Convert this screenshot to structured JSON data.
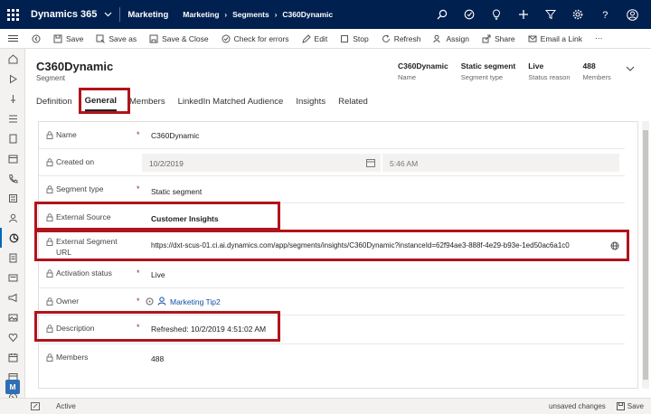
{
  "topbar": {
    "app_title": "Dynamics 365",
    "area": "Marketing",
    "breadcrumb": [
      "Marketing",
      "Segments",
      "C360Dynamic"
    ]
  },
  "commands": [
    {
      "label": "Save",
      "icon": "save-icon"
    },
    {
      "label": "Save as",
      "icon": "save-as-icon"
    },
    {
      "label": "Save & Close",
      "icon": "save-close-icon"
    },
    {
      "label": "Check for errors",
      "icon": "check-circle-icon"
    },
    {
      "label": "Edit",
      "icon": "edit-icon"
    },
    {
      "label": "Stop",
      "icon": "stop-icon"
    },
    {
      "label": "Refresh",
      "icon": "refresh-icon"
    },
    {
      "label": "Assign",
      "icon": "assign-icon"
    },
    {
      "label": "Share",
      "icon": "share-icon"
    },
    {
      "label": "Email a Link",
      "icon": "email-icon"
    }
  ],
  "record": {
    "title": "C360Dynamic",
    "subtitle": "Segment",
    "header_fields": [
      {
        "value": "C360Dynamic",
        "label": "Name"
      },
      {
        "value": "Static segment",
        "label": "Segment type"
      },
      {
        "value": "Live",
        "label": "Status reason"
      },
      {
        "value": "488",
        "label": "Members"
      }
    ]
  },
  "tabs": [
    "Definition",
    "General",
    "Members",
    "LinkedIn Matched Audience",
    "Insights",
    "Related"
  ],
  "active_tab": "General",
  "form": {
    "name": {
      "label": "Name",
      "value": "C360Dynamic"
    },
    "created_on": {
      "label": "Created on",
      "date": "10/2/2019",
      "time": "5:46 AM"
    },
    "segment_type": {
      "label": "Segment type",
      "value": "Static segment"
    },
    "external_source": {
      "label": "External Source",
      "value": "Customer Insights"
    },
    "external_url": {
      "label_line1": "External Segment",
      "label_line2": "URL",
      "value": "https://dxt-scus-01.ci.ai.dynamics.com/app/segments/insights/C360Dynamic?instanceId=62f94ae3-888f-4e29-b93e-1ed50ac6a1c0"
    },
    "activation_status": {
      "label": "Activation status",
      "value": "Live"
    },
    "owner": {
      "label": "Owner",
      "value": "Marketing Tip2"
    },
    "description": {
      "label": "Description",
      "value": "Refreshed: 10/2/2019 4:51:02 AM"
    },
    "members": {
      "label": "Members",
      "value": "488"
    },
    "required_mark": "*"
  },
  "statusbar": {
    "state": "Active",
    "unsaved": "unsaved changes",
    "save": "Save"
  },
  "user_initial": "M",
  "colors": {
    "nav": "#002050",
    "highlight": "#b0141c",
    "link": "#0f4fa8"
  }
}
